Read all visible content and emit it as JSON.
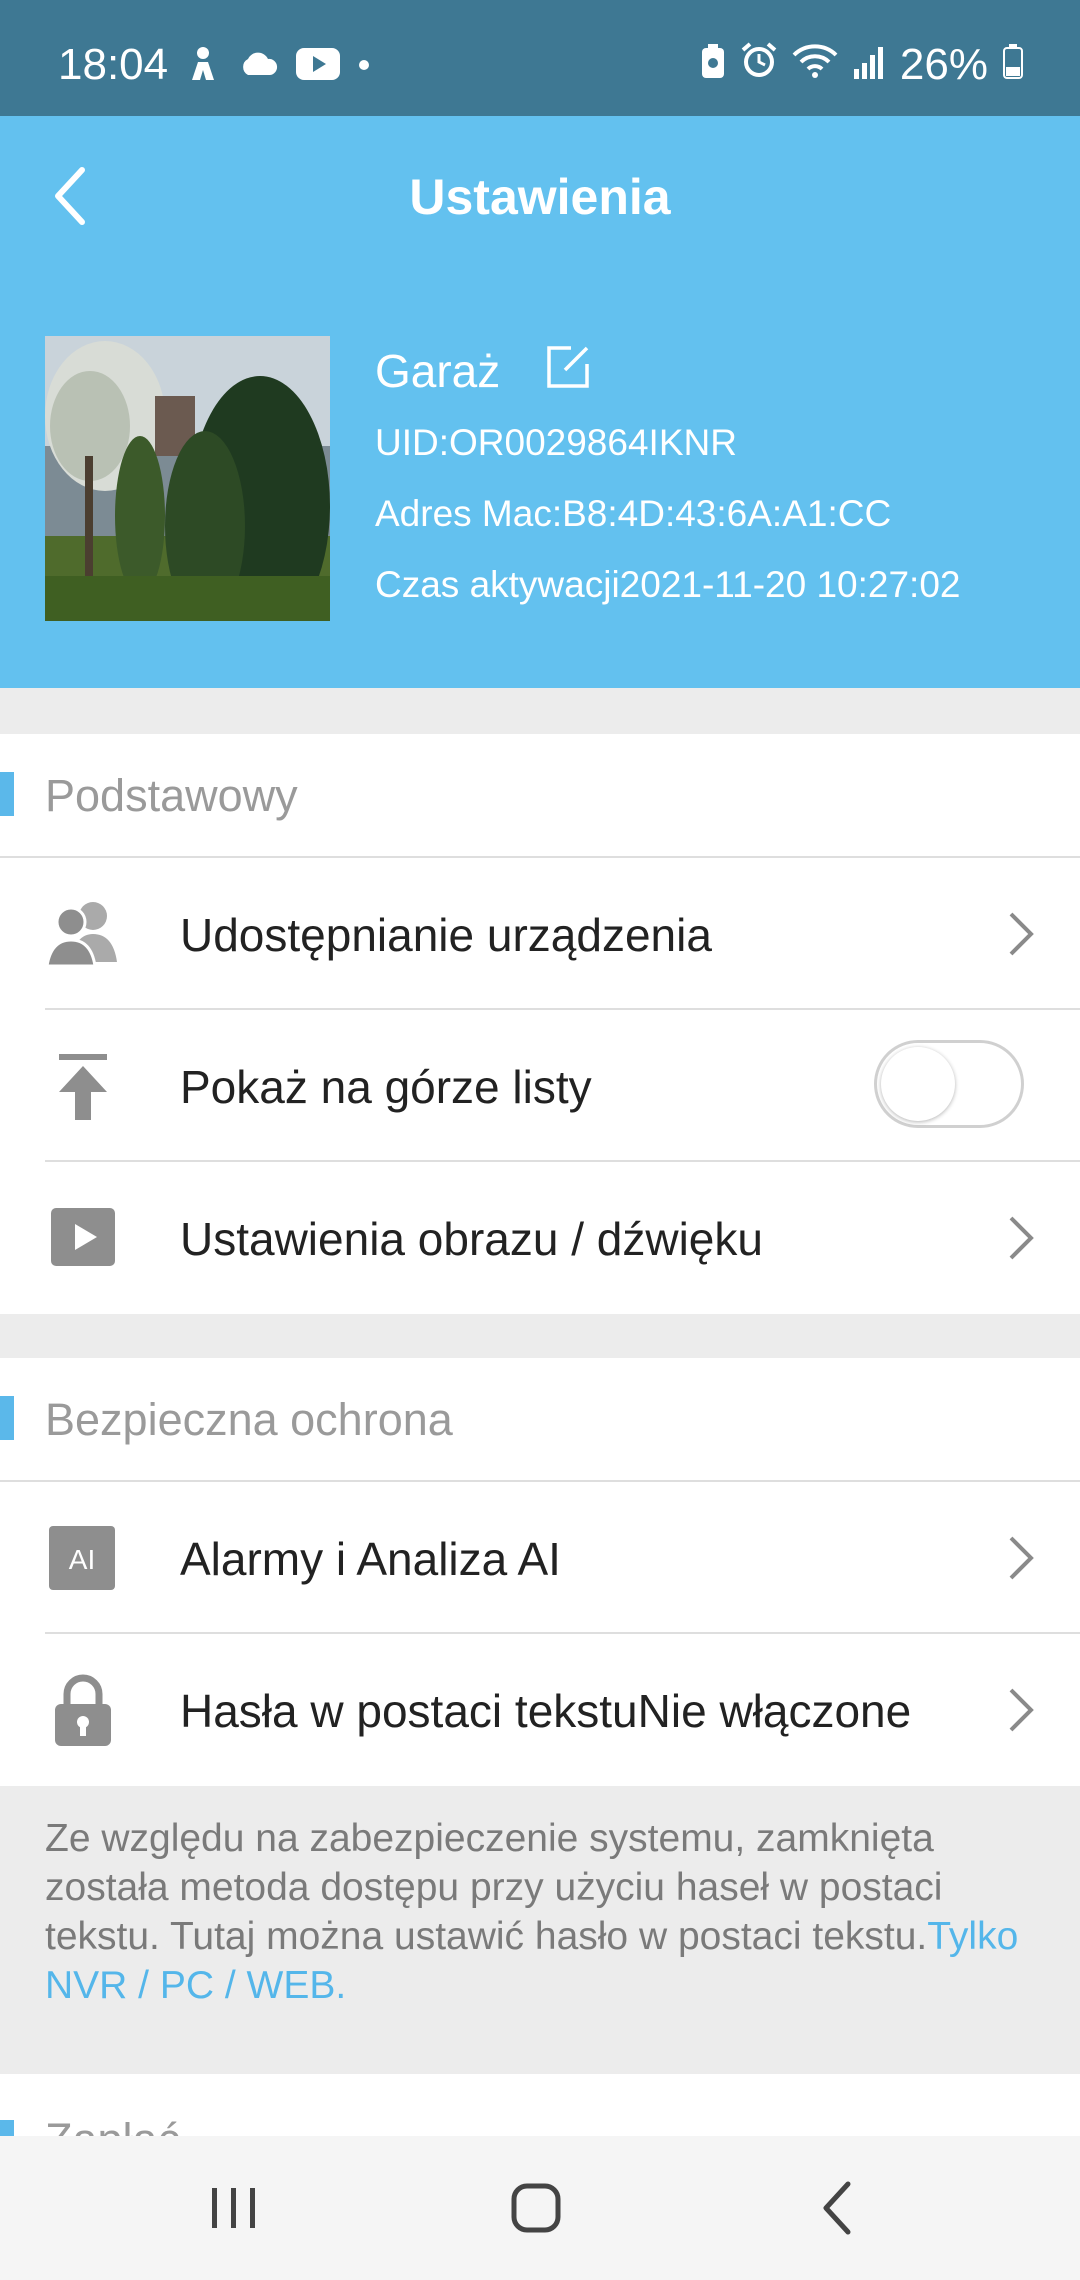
{
  "status_bar": {
    "time": "18:04",
    "battery": "26%",
    "left_icons": [
      "cast-person-icon",
      "cloud-icon",
      "youtube-icon",
      "dot-icon"
    ],
    "right_icons": [
      "battery-saver-icon",
      "alarm-icon",
      "wifi-icon",
      "signal-icon",
      "battery-icon"
    ]
  },
  "header": {
    "title": "Ustawienia",
    "device": {
      "name": "Garaż",
      "uid": "UID:OR0029864IKNR",
      "mac": "Adres Mac:B8:4D:43:6A:A1:CC",
      "activation": "Czas aktywacji2021-11-20 10:27:02"
    }
  },
  "sections": {
    "basic": {
      "title": "Podstawowy",
      "items": [
        {
          "label": "Udostępnianie urządzenia",
          "icon": "users-icon",
          "control": "chevron"
        },
        {
          "label": "Pokaż na górze listy",
          "icon": "pin-top-icon",
          "control": "toggle",
          "toggle_on": false
        },
        {
          "label": "Ustawienia obrazu / dźwięku",
          "icon": "play-icon",
          "control": "chevron"
        }
      ]
    },
    "security": {
      "title": "Bezpieczna ochrona",
      "items": [
        {
          "label": "Alarmy i Analiza AI",
          "icon": "ai-icon",
          "icon_text": "AI",
          "control": "chevron"
        },
        {
          "label": "Hasła w postaci tekstuNie włączone",
          "icon": "lock-icon",
          "control": "chevron"
        }
      ],
      "note": "Ze względu na zabezpieczenie systemu, zamknięta została metoda dostępu przy użyciu haseł w postaci tekstu. Tutaj można ustawić hasło w postaci tekstu.",
      "note_link": "Tylko NVR / PC / WEB."
    },
    "partial": {
      "title": "Zapłać"
    }
  },
  "colors": {
    "status_bar": "#3e7893",
    "header": "#63c1ef",
    "accent": "#5bb8ea",
    "background": "#ececec"
  }
}
